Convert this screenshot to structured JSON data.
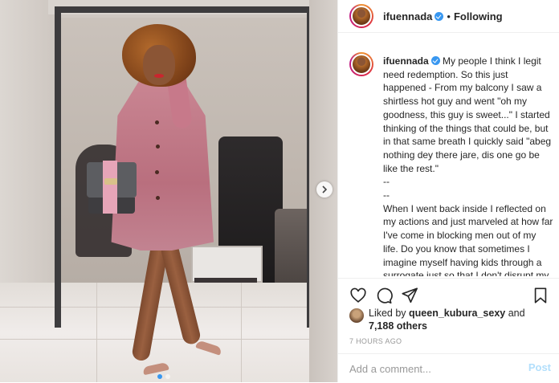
{
  "header": {
    "username": "ifuennada",
    "separator": "•",
    "follow_label": "Following"
  },
  "caption": {
    "username": "ifuennada",
    "text": " My people I think I legit need redemption. So this just happened - From my balcony I saw a shirtless hot guy and went \"oh my goodness, this guy is sweet...\" I started thinking of the things that could be, but in that same breath I quickly said \"abeg nothing dey there jare, dis one go be like the rest.\"\n--\n--\nWhen I went back inside I reflected on my actions and just marveled at how far I've come in blocking men out of my life. Do you know that sometimes I imagine myself having kids through a surrogate just so that I don't disrupt my life and future with the problems that come with being in a relationship."
  },
  "actions": {
    "like_icon": "heart-icon",
    "comment_icon": "comment-icon",
    "share_icon": "share-icon",
    "save_icon": "bookmark-icon"
  },
  "likes": {
    "prefix": "Liked by ",
    "liker": "queen_kubura_sexy",
    "middle": " and",
    "others": "7,188 others"
  },
  "timestamp": "7 HOURS AGO",
  "comment": {
    "placeholder": "Add a comment...",
    "post_label": "Post"
  },
  "carousel": {
    "next_icon": "chevron-right-icon",
    "slide_count": 2,
    "active_index": 0
  },
  "colors": {
    "accent": "#3897f0",
    "post_disabled": "#b2dffc",
    "border": "#efefef"
  }
}
